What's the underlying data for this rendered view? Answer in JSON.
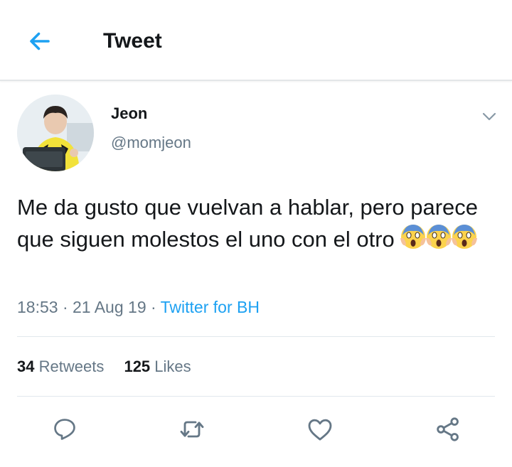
{
  "header": {
    "title": "Tweet",
    "back_icon": "arrow-left-icon"
  },
  "author": {
    "name": "Jeon",
    "handle": "@momjeon",
    "avatar_icon": "profile-photo"
  },
  "tweet": {
    "text": "Me da gusto que vuelvan a hablar, pero parece que siguen molestos el uno con el otro",
    "emojis": [
      "scream-emoji",
      "scream-emoji",
      "scream-emoji"
    ]
  },
  "meta": {
    "time": "18:53",
    "sep1": " · ",
    "date": "21 Aug 19",
    "sep2": " · ",
    "source": "Twitter for BH"
  },
  "stats": {
    "retweets_count": "34",
    "retweets_label": "Retweets",
    "likes_count": "125",
    "likes_label": "Likes"
  },
  "actions": [
    "reply-icon",
    "retweet-icon",
    "like-icon",
    "share-icon"
  ],
  "colors": {
    "accent": "#1da1f2",
    "secondary_text": "#657786",
    "primary_text": "#14171a",
    "divider": "#e1e8ed"
  }
}
